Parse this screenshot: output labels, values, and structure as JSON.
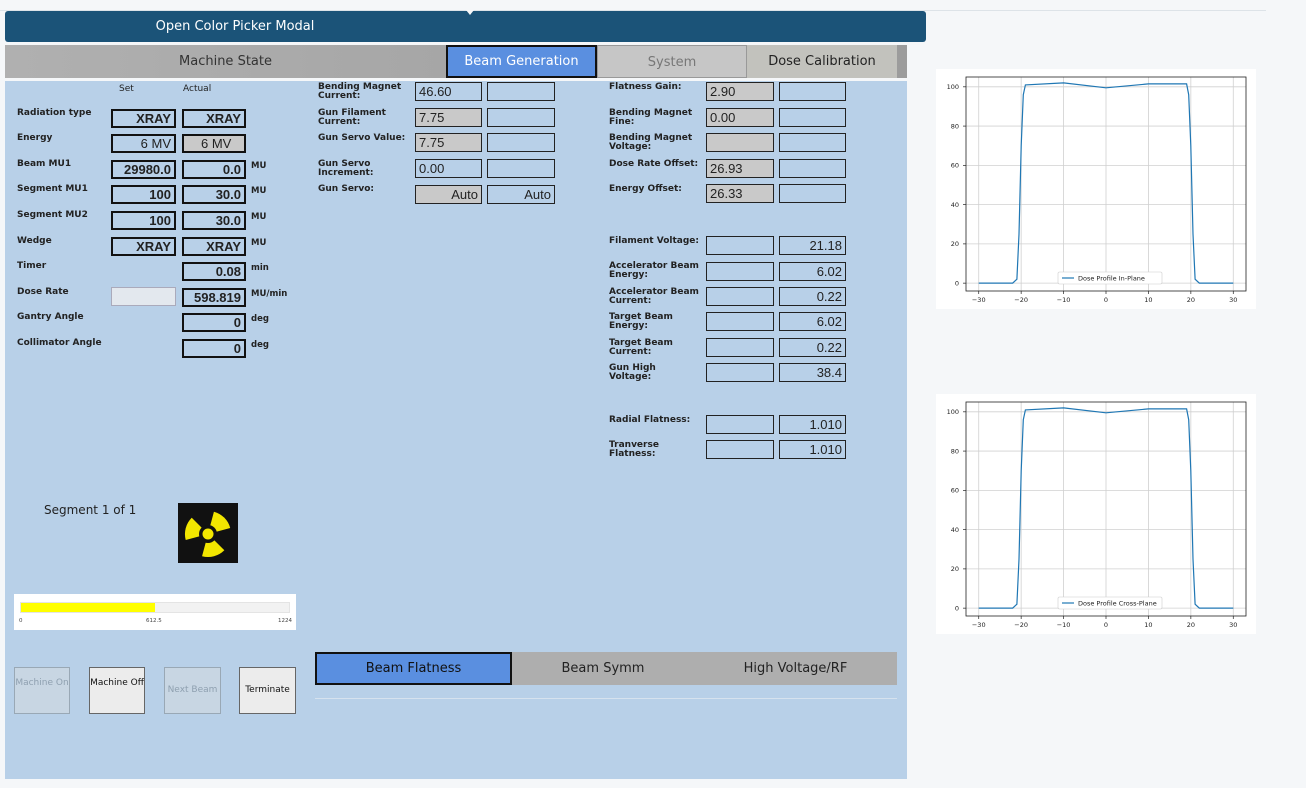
{
  "modal_button": {
    "label": "Open Color Picker Modal"
  },
  "tabs": [
    {
      "label": "Machine State"
    },
    {
      "label": "Beam Generation"
    },
    {
      "label": "System"
    },
    {
      "label": "Dose Calibration"
    }
  ],
  "machine_state": {
    "header_set": "Set",
    "header_actual": "Actual",
    "rows": [
      {
        "label": "Radiation type",
        "set": "XRAY",
        "actual": "XRAY",
        "unit": ""
      },
      {
        "label": "Energy",
        "set": "6 MV",
        "actual": "6 MV",
        "unit": ""
      },
      {
        "label": "Beam MU1",
        "set": "29980.0",
        "actual": "0.0",
        "unit": "MU"
      },
      {
        "label": "Segment MU1",
        "set": "100",
        "actual": "30.0",
        "unit": "MU"
      },
      {
        "label": "Segment MU2",
        "set": "100",
        "actual": "30.0",
        "unit": "MU"
      },
      {
        "label": "Wedge",
        "set": "XRAY",
        "actual": "XRAY",
        "unit": "MU"
      },
      {
        "label": "Timer",
        "set": "",
        "actual": "0.08",
        "unit": "min"
      },
      {
        "label": "Dose Rate",
        "set": "",
        "actual": "598.819",
        "unit": "MU/min"
      },
      {
        "label": "Gantry Angle",
        "set": "",
        "actual": "0",
        "unit": "deg"
      },
      {
        "label": "Collimator Angle",
        "set": "",
        "actual": "0",
        "unit": "deg"
      }
    ],
    "segment_text": "Segment 1 of 1",
    "progress": {
      "value": 612.5,
      "max": 1224,
      "min_label": "0",
      "mid_label": "612.5",
      "max_label": "1224"
    }
  },
  "beam_generation": {
    "col_a": [
      {
        "label": "Bending Magnet Current:",
        "value": "46.60",
        "value2": ""
      },
      {
        "label": "Gun Filament Current:",
        "value": "7.75",
        "value2": ""
      },
      {
        "label": "Gun Servo Value:",
        "value": "7.75",
        "value2": ""
      },
      {
        "label": "Gun Servo Increment:",
        "value": "0.00",
        "value2": ""
      },
      {
        "label": "Gun Servo:",
        "value": "Auto",
        "value2": "Auto"
      }
    ],
    "col_b": [
      {
        "label": "Flatness Gain:",
        "value": "2.90",
        "value2": ""
      },
      {
        "label": "Bending Magnet Fine:",
        "value": "0.00",
        "value2": ""
      },
      {
        "label": "Bending Magnet Voltage:",
        "value": "",
        "value2": ""
      },
      {
        "label": "Dose Rate Offset:",
        "value": "26.93",
        "value2": ""
      },
      {
        "label": "Energy Offset:",
        "value": "26.33",
        "value2": ""
      }
    ],
    "col_c": [
      {
        "label": "Filament Voltage:",
        "value": "",
        "value2": "21.18"
      },
      {
        "label": "Accelerator Beam Energy:",
        "value": "",
        "value2": "6.02"
      },
      {
        "label": "Accelerator Beam Current:",
        "value": "",
        "value2": "0.22"
      },
      {
        "label": "Target Beam Energy:",
        "value": "",
        "value2": "6.02"
      },
      {
        "label": "Target Beam Current:",
        "value": "",
        "value2": "0.22"
      },
      {
        "label": "Gun High Voltage:",
        "value": "",
        "value2": "38.4"
      }
    ],
    "col_d": [
      {
        "label": "Radial Flatness:",
        "value": "",
        "value2": "1.010"
      },
      {
        "label": "Tranverse Flatness:",
        "value": "",
        "value2": "1.010"
      }
    ]
  },
  "controls": {
    "machine_on": "Machine On",
    "machine_off": "Machine Off",
    "next_beam": "Next Beam",
    "terminate": "Terminate"
  },
  "bottom_tabs": [
    {
      "label": "Beam Flatness"
    },
    {
      "label": "Beam Symm"
    },
    {
      "label": "High Voltage/RF"
    }
  ],
  "colors": {
    "header": "#1b5378",
    "panel": "#b8d0e8",
    "active_tab": "#5a8fe0",
    "progress": "#ffff00",
    "line": "#1f77b4"
  },
  "chart_data": [
    {
      "type": "line",
      "xlim": [
        -33,
        33
      ],
      "ylim": [
        -4,
        105
      ],
      "xticks": [
        -30,
        -20,
        -10,
        0,
        10,
        20,
        30
      ],
      "xtick_labels": [
        "−30",
        "−20",
        "−10",
        "0",
        "10",
        "20",
        "30"
      ],
      "yticks": [
        0,
        20,
        40,
        60,
        80,
        100
      ],
      "grid": true,
      "legend": "bottom-center",
      "series": [
        {
          "name": "Dose Profile In-Plane",
          "x": [
            -30,
            -22,
            -21,
            -20.5,
            -20,
            -19.5,
            -19,
            -10,
            0,
            10,
            19,
            19.5,
            20,
            20.5,
            21,
            22,
            30
          ],
          "y": [
            0,
            0,
            2,
            25,
            70,
            96,
            101,
            102,
            99.5,
            101.5,
            101.5,
            96,
            70,
            25,
            2,
            0,
            0
          ]
        }
      ]
    },
    {
      "type": "line",
      "xlim": [
        -33,
        33
      ],
      "ylim": [
        -4,
        105
      ],
      "xticks": [
        -30,
        -20,
        -10,
        0,
        10,
        20,
        30
      ],
      "xtick_labels": [
        "−30",
        "−20",
        "−10",
        "0",
        "10",
        "20",
        "30"
      ],
      "yticks": [
        0,
        20,
        40,
        60,
        80,
        100
      ],
      "grid": true,
      "legend": "bottom-center",
      "series": [
        {
          "name": "Dose Profile Cross-Plane",
          "x": [
            -30,
            -22,
            -21,
            -20.5,
            -20,
            -19.5,
            -19,
            -10,
            0,
            10,
            19,
            19.5,
            20,
            20.5,
            21,
            22,
            30
          ],
          "y": [
            0,
            0,
            2,
            25,
            70,
            96,
            101,
            102,
            99.5,
            101.5,
            101.5,
            96,
            70,
            25,
            2,
            0,
            0
          ]
        }
      ]
    }
  ]
}
